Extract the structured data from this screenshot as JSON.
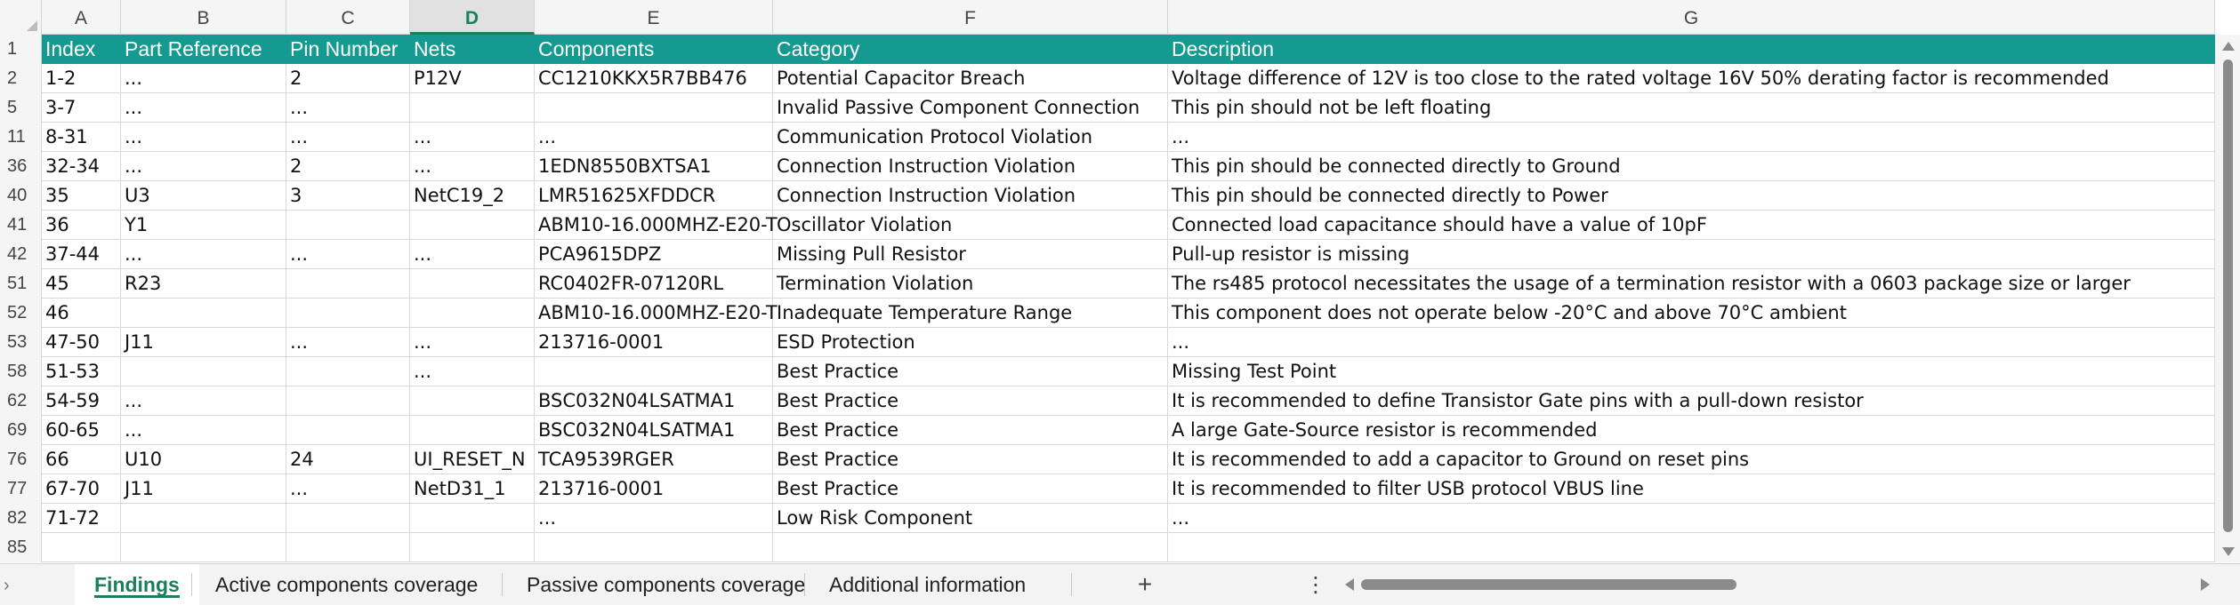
{
  "columns": [
    "A",
    "B",
    "C",
    "D",
    "E",
    "F",
    "G"
  ],
  "selected_column": "D",
  "header_row": {
    "num": "1",
    "cells": [
      "Index",
      "Part Reference",
      "Pin Number",
      "Nets",
      "Components",
      "Category",
      "Description"
    ]
  },
  "rows": [
    {
      "num": "2",
      "cells": [
        "1-2",
        "...",
        "2",
        "P12V",
        "CC1210KKX5R7BB476",
        "Potential Capacitor Breach",
        "Voltage difference of 12V is too close to the rated voltage 16V             50% derating factor is recommended"
      ]
    },
    {
      "num": "5",
      "cells": [
        "3-7",
        "...",
        "...",
        "",
        "",
        "Invalid Passive Component Connection",
        "This pin should not be left floating"
      ]
    },
    {
      "num": "11",
      "cells": [
        "8-31",
        "...",
        "...",
        "...",
        "...",
        "Communication Protocol Violation",
        "..."
      ]
    },
    {
      "num": "36",
      "cells": [
        "32-34",
        "...",
        "2",
        "...",
        "1EDN8550BXTSA1",
        "Connection Instruction Violation",
        "This pin should be connected directly to Ground"
      ]
    },
    {
      "num": "40",
      "cells": [
        "35",
        "U3",
        "3",
        "NetC19_2",
        "LMR51625XFDDCR",
        "Connection Instruction Violation",
        "This pin should be connected directly to Power"
      ]
    },
    {
      "num": "41",
      "cells": [
        "36",
        "Y1",
        "",
        "",
        "ABM10-16.000MHZ-E20-T",
        "Oscillator Violation",
        "Connected load capacitance should have a value of 10pF"
      ]
    },
    {
      "num": "42",
      "cells": [
        "37-44",
        "...",
        "...",
        "...",
        "PCA9615DPZ",
        "Missing Pull Resistor",
        "Pull-up resistor is missing"
      ]
    },
    {
      "num": "51",
      "cells": [
        "45",
        "R23",
        "",
        "",
        "RC0402FR-07120RL",
        "Termination Violation",
        "The rs485 protocol necessitates the usage of a termination resistor with a 0603 package size or larger"
      ]
    },
    {
      "num": "52",
      "cells": [
        "46",
        "",
        "",
        "",
        "ABM10-16.000MHZ-E20-T",
        "Inadequate Temperature Range",
        "This component does not operate below -20°C and above 70°C ambient"
      ]
    },
    {
      "num": "53",
      "cells": [
        "47-50",
        "J11",
        "...",
        "...",
        "213716-0001",
        "ESD Protection",
        "..."
      ]
    },
    {
      "num": "58",
      "cells": [
        "51-53",
        "",
        "",
        "...",
        "",
        "Best Practice",
        "Missing Test Point"
      ]
    },
    {
      "num": "62",
      "cells": [
        "54-59",
        "...",
        "",
        "",
        "BSC032N04LSATMA1",
        "Best Practice",
        "It is recommended to define Transistor Gate pins with a pull-down resistor"
      ]
    },
    {
      "num": "69",
      "cells": [
        "60-65",
        "...",
        "",
        "",
        "BSC032N04LSATMA1",
        "Best Practice",
        "A large Gate-Source resistor is recommended"
      ]
    },
    {
      "num": "76",
      "cells": [
        "66",
        "U10",
        "24",
        "UI_RESET_N",
        "TCA9539RGER",
        "Best Practice",
        "It is recommended to add a capacitor to Ground on reset pins"
      ]
    },
    {
      "num": "77",
      "cells": [
        "67-70",
        "J11",
        "...",
        "NetD31_1",
        "213716-0001",
        "Best Practice",
        "It is recommended to filter USB protocol VBUS line"
      ]
    },
    {
      "num": "82",
      "cells": [
        "71-72",
        "",
        "",
        "",
        "...",
        "Low Risk Component",
        "..."
      ]
    },
    {
      "num": "85",
      "cells": [
        "",
        "",
        "",
        "",
        "",
        "",
        ""
      ]
    }
  ],
  "sheet_tabs": [
    {
      "label": "Findings",
      "active": true
    },
    {
      "label": "Active components coverage",
      "active": false
    },
    {
      "label": "Passive components coverage",
      "active": false
    },
    {
      "label": "Additional information",
      "active": false
    }
  ],
  "tabbar": {
    "nav_prev": "›",
    "add_tab": "+",
    "more": "⋮"
  },
  "colors": {
    "header_fill": "#149a90",
    "accent": "#1a7f5a"
  }
}
